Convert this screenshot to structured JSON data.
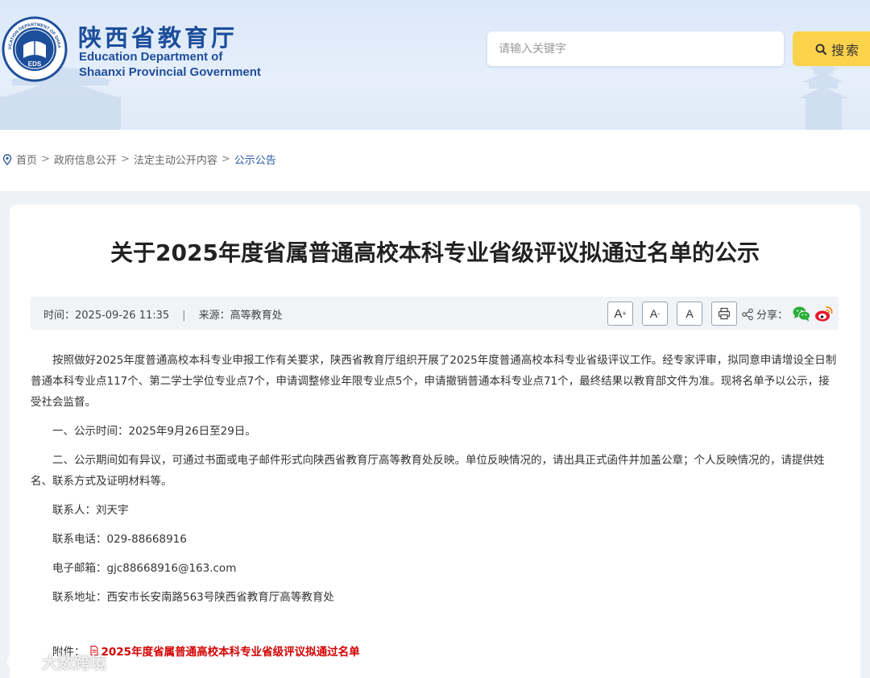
{
  "header": {
    "title_cn": "陕西省教育厅",
    "title_en_line1": "Education Department of",
    "title_en_line2": "Shaanxi Provincial Government",
    "emblem_text": "EDUCATION DEPARTMENT OF SHAANXI · 陕西省教育厅 · EDS",
    "search_placeholder": "请输入关键字",
    "search_button": "搜索",
    "brand_color": "#1d4e9b",
    "search_button_color": "#fbd24b"
  },
  "breadcrumb": {
    "items": [
      "首页",
      "政府信息公开",
      "法定主动公开内容",
      "公示公告"
    ],
    "separator": ">"
  },
  "article": {
    "title": "关于2025年度省属普通高校本科专业省级评议拟通过名单的公示",
    "time_label": "时间：",
    "time_value": "2025-09-26 11:35",
    "meta_divider": "|",
    "source_label": "来源：",
    "source_value": "高等教育处",
    "font_buttons": [
      "A",
      "A",
      "A"
    ],
    "share_label": "分享：",
    "paragraphs": [
      "按照做好2025年度普通高校本科专业申报工作有关要求，陕西省教育厅组织开展了2025年度普通高校本科专业省级评议工作。经专家评审，拟同意申请增设全日制普通本科专业点117个、第二学士学位专业点7个，申请调整修业年限专业点5个，申请撤销普通本科专业点71个，最终结果以教育部文件为准。现将名单予以公示，接受社会监督。",
      "一、公示时间：2025年9月26日至29日。",
      "二、公示期间如有异议，可通过书面或电子邮件形式向陕西省教育厅高等教育处反映。单位反映情况的，请出具正式函件并加盖公章；个人反映情况的，请提供姓名、联系方式及证明材料等。"
    ],
    "contacts": [
      "联系人：刘天宇",
      "联系电话：029-88668916",
      "电子邮箱：gjc88668916@163.com",
      "联系地址：西安市长安南路563号陕西省教育厅高等教育处"
    ],
    "attachment_label": "附件：",
    "attachment_link": "2025年度省属普通高校本科专业省级评议拟通过名单",
    "attachment_color": "#d40000"
  },
  "watermark": "大数跨境"
}
